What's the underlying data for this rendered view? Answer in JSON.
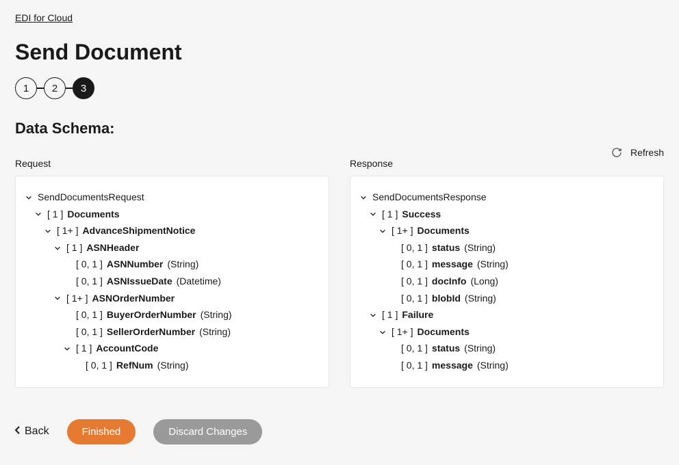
{
  "breadcrumb": "EDI for Cloud",
  "title": "Send Document",
  "stepper": {
    "steps": [
      "1",
      "2",
      "3"
    ],
    "active_index": 2
  },
  "section_title": "Data Schema:",
  "refresh_label": "Refresh",
  "columns": {
    "request": {
      "title": "Request",
      "root": "SendDocumentsRequest"
    },
    "response": {
      "title": "Response",
      "root": "SendDocumentsResponse"
    }
  },
  "tree": {
    "request": [
      {
        "indent": 0,
        "exp": true,
        "card": "",
        "name": "SendDocumentsRequest",
        "type": ""
      },
      {
        "indent": 1,
        "exp": true,
        "card": "[ 1 ]",
        "name": "Documents",
        "type": ""
      },
      {
        "indent": 2,
        "exp": true,
        "card": "[ 1+ ]",
        "name": "AdvanceShipmentNotice",
        "type": ""
      },
      {
        "indent": 3,
        "exp": true,
        "card": "[ 1 ]",
        "name": "ASNHeader",
        "type": ""
      },
      {
        "indent": 4,
        "exp": false,
        "card": "[ 0, 1 ]",
        "name": "ASNNumber",
        "type": "(String)"
      },
      {
        "indent": 4,
        "exp": false,
        "card": "[ 0, 1 ]",
        "name": "ASNIssueDate",
        "type": "(Datetime)"
      },
      {
        "indent": 3,
        "exp": true,
        "card": "[ 1+ ]",
        "name": "ASNOrderNumber",
        "type": ""
      },
      {
        "indent": 4,
        "exp": false,
        "card": "[ 0, 1 ]",
        "name": "BuyerOrderNumber",
        "type": "(String)"
      },
      {
        "indent": 4,
        "exp": false,
        "card": "[ 0, 1 ]",
        "name": "SellerOrderNumber",
        "type": "(String)"
      },
      {
        "indent": 4,
        "exp": true,
        "card": "[ 1 ]",
        "name": "AccountCode",
        "type": ""
      },
      {
        "indent": 5,
        "exp": false,
        "card": "[ 0, 1 ]",
        "name": "RefNum",
        "type": "(String)"
      }
    ],
    "response": [
      {
        "indent": 0,
        "exp": true,
        "card": "",
        "name": "SendDocumentsResponse",
        "type": ""
      },
      {
        "indent": 1,
        "exp": true,
        "card": "[ 1 ]",
        "name": "Success",
        "type": ""
      },
      {
        "indent": 2,
        "exp": true,
        "card": "[ 1+ ]",
        "name": "Documents",
        "type": ""
      },
      {
        "indent": 3,
        "exp": false,
        "card": "[ 0, 1 ]",
        "name": "status",
        "type": "(String)"
      },
      {
        "indent": 3,
        "exp": false,
        "card": "[ 0, 1 ]",
        "name": "message",
        "type": "(String)"
      },
      {
        "indent": 3,
        "exp": false,
        "card": "[ 0, 1 ]",
        "name": "docInfo",
        "type": "(Long)"
      },
      {
        "indent": 3,
        "exp": false,
        "card": "[ 0, 1 ]",
        "name": "blobId",
        "type": "(String)"
      },
      {
        "indent": 1,
        "exp": true,
        "card": "[ 1 ]",
        "name": "Failure",
        "type": ""
      },
      {
        "indent": 2,
        "exp": true,
        "card": "[ 1+ ]",
        "name": "Documents",
        "type": ""
      },
      {
        "indent": 3,
        "exp": false,
        "card": "[ 0, 1 ]",
        "name": "status",
        "type": "(String)"
      },
      {
        "indent": 3,
        "exp": false,
        "card": "[ 0, 1 ]",
        "name": "message",
        "type": "(String)"
      }
    ]
  },
  "footer": {
    "back": "Back",
    "finished": "Finished",
    "discard": "Discard Changes"
  }
}
